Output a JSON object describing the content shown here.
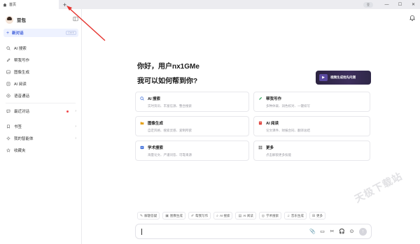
{
  "titlebar": {
    "tab_label": "首页",
    "new_tab": "+",
    "user_chip": "豆",
    "minimize": "—",
    "maximize": "☐",
    "close": "✕"
  },
  "sidebar": {
    "brand": "豆包",
    "new_chat": {
      "label": "新对话",
      "shortcut": "Ctrl K"
    },
    "items": [
      {
        "label": "AI 搜索",
        "icon": "search-icon"
      },
      {
        "label": "帮我写作",
        "icon": "pen-icon"
      },
      {
        "label": "图像生成",
        "icon": "image-icon"
      },
      {
        "label": "AI 阅读",
        "icon": "book-icon"
      },
      {
        "label": "语音通话",
        "icon": "phone-icon"
      }
    ],
    "sections": [
      {
        "label": "最近对话",
        "icon": "chat-icon",
        "has_dot": true
      },
      {
        "label": "书签",
        "icon": "bookmark-icon"
      },
      {
        "label": "我的智能体",
        "icon": "agent-icon"
      },
      {
        "label": "收藏夹",
        "icon": "star-icon"
      }
    ]
  },
  "main": {
    "greeting": "你好，用户nx1GMe",
    "question": "我可以如何帮到你?",
    "banner": "视频生成抢先内测",
    "cards": [
      {
        "title": "AI 搜索",
        "sub": "实时资讯、丰富信源、整合搜索",
        "color": "#3a6bd9"
      },
      {
        "title": "帮我写作",
        "sub": "多种体裁、润色校对、一键续写",
        "color": "#2fa55a"
      },
      {
        "title": "图像生成",
        "sub": "自定风格、搜索灵感、爱制所欲",
        "color": "#e5a21c"
      },
      {
        "title": "AI 阅读",
        "sub": "论文课件、财报合同、翻译总结",
        "color": "#e0443e"
      },
      {
        "title": "学术搜索",
        "sub": "海量论文、严谨问答、可靠来源",
        "color": "#3a6bd9"
      },
      {
        "title": "更多",
        "sub": "点击解锁更多技能",
        "color": "#777777"
      }
    ],
    "chips": [
      {
        "label": "解题答疑",
        "icon": "✎"
      },
      {
        "label": "图像生成",
        "icon": "▣"
      },
      {
        "label": "帮我写作",
        "icon": "✐"
      },
      {
        "label": "AI 搜索",
        "icon": "⌕"
      },
      {
        "label": "AI 阅读",
        "icon": "▤"
      },
      {
        "label": "学术搜索",
        "icon": "◎"
      },
      {
        "label": "音乐生成",
        "icon": "♫"
      },
      {
        "label": "更多",
        "icon": "⊞"
      }
    ],
    "watermark": "天极下载站",
    "input": {
      "tools": [
        "📎",
        "▭",
        "✂",
        "🎧",
        "⊙"
      ],
      "send": "↑"
    }
  }
}
